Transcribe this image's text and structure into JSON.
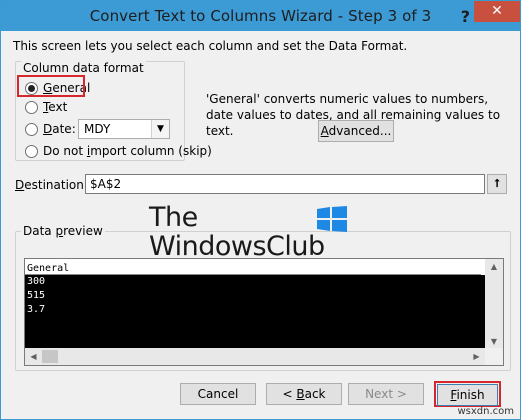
{
  "window": {
    "title": "Convert Text to Columns Wizard - Step 3 of 3",
    "help_label": "?",
    "close_label": "✕",
    "accent_color": "#3c9ad5",
    "close_color": "#c7503f"
  },
  "intro_text": "This screen lets you select each column and set the Data Format.",
  "column_format": {
    "legend": "Column data format",
    "options": [
      {
        "before": "",
        "accel": "G",
        "after": "eneral",
        "checked": true
      },
      {
        "before": "",
        "accel": "T",
        "after": "ext",
        "checked": false
      },
      {
        "before": "",
        "accel": "D",
        "after": "ate:",
        "checked": false
      },
      {
        "before": "Do not ",
        "accel": "i",
        "after": "mport column (skip)",
        "checked": false
      }
    ],
    "date_value": "MDY",
    "highlight_color": "#d6282c"
  },
  "description": "'General' converts numeric values to numbers, date values to dates, and all remaining values to text.",
  "advanced_button": {
    "accel": "A",
    "rest": "dvanced..."
  },
  "destination": {
    "label_accel": "D",
    "label_rest": "estination:",
    "value": "$A$2",
    "collapse_icon": "⭡"
  },
  "preview": {
    "legend_before": "Data ",
    "legend_accel": "p",
    "legend_after": "review",
    "header": "General",
    "rows": [
      "300",
      "515",
      "3.7"
    ]
  },
  "watermark": {
    "line1": "The",
    "line2": "WindowsClub",
    "logo_color": "#1e88e5"
  },
  "buttons": {
    "cancel": "Cancel",
    "back_prefix": "< ",
    "back_accel": "B",
    "back_rest": "ack",
    "next": "Next >",
    "finish_accel": "F",
    "finish_rest": "inish"
  },
  "site_tag": "wsxdn.com"
}
